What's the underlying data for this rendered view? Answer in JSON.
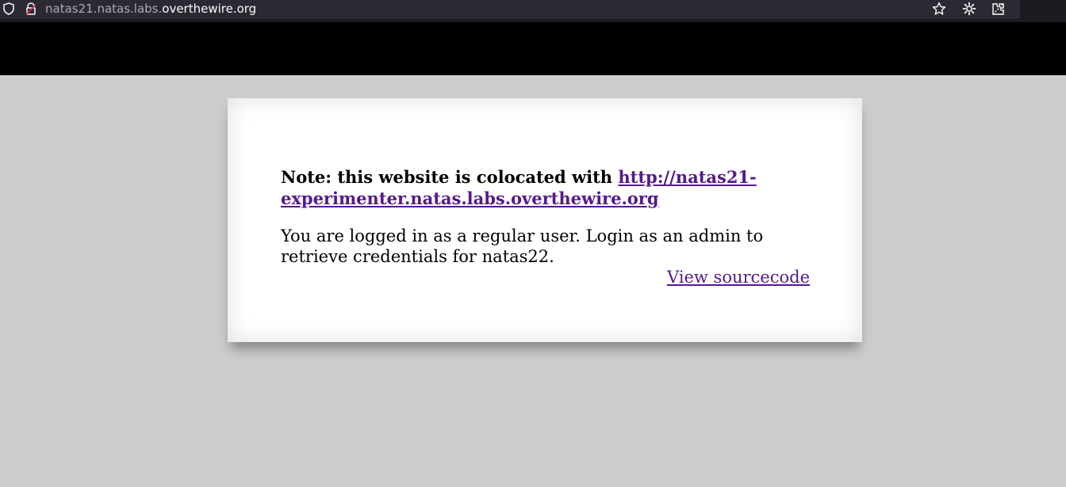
{
  "browser": {
    "url_prefix": "natas21.natas.labs.",
    "url_domain": "overthewire.org",
    "icons": [
      "shield-icon",
      "lock-icon",
      "star-icon",
      "gear-icon",
      "extension-icon"
    ]
  },
  "page": {
    "note_label": "Note: this website is colocated with ",
    "note_link": "http://natas21-experimenter.natas.labs.overthewire.org",
    "message": "You are logged in as a regular user. Login as an admin to retrieve credentials for natas22.",
    "source_link": "View sourcecode"
  },
  "colors": {
    "page_background": "#cccccc",
    "header_background": "#000000",
    "card_background": "#ffffff",
    "link": "#551a8b"
  }
}
